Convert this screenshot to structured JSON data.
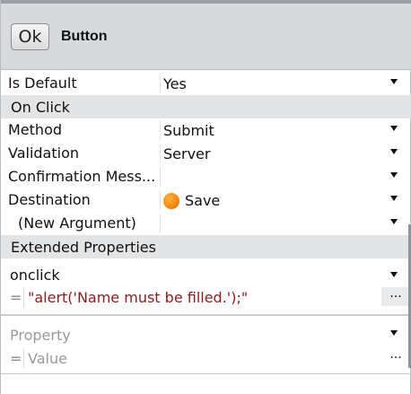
{
  "header": {
    "ok_label": "Ok",
    "title": "Button"
  },
  "rows": {
    "is_default": {
      "name": "Is Default",
      "value": "Yes"
    },
    "on_click_section": "On Click",
    "method": {
      "name": "Method",
      "value": "Submit"
    },
    "validation": {
      "name": "Validation",
      "value": "Server"
    },
    "confirmation": {
      "name": "Confirmation Mess...",
      "value": ""
    },
    "destination": {
      "name": "Destination",
      "value": "Save"
    },
    "new_argument": {
      "name": "(New Argument)",
      "value": ""
    },
    "extended_section": "Extended Properties"
  },
  "extended": {
    "property1": {
      "name": "onclick",
      "equals": "=",
      "value": "\"alert('Name must be filled.');\"",
      "dots": "..."
    },
    "property2": {
      "name": "Property",
      "equals": "=",
      "value": "Value",
      "dots": "..."
    }
  },
  "icons": {
    "dropdown": "chevron-down-icon",
    "destination": "orange-circle-icon"
  },
  "colors": {
    "header_bg": "#d6dadd",
    "section_bg": "#e3e4e6",
    "expression_text": "#8b1c1c",
    "placeholder_text": "#9a9a9a"
  }
}
